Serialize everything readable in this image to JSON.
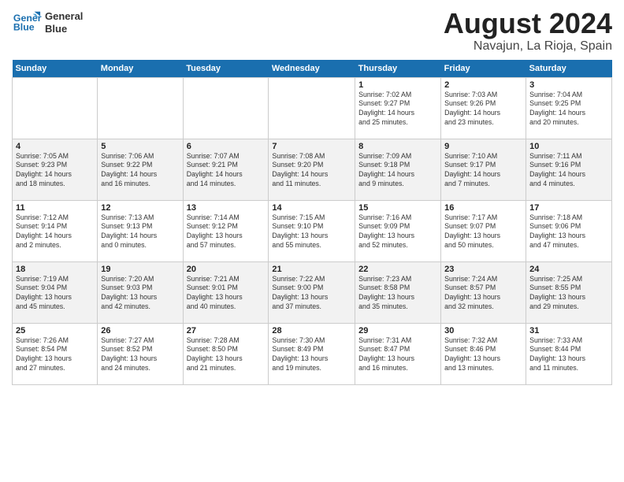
{
  "logo": {
    "line1": "General",
    "line2": "Blue"
  },
  "title": "August 2024",
  "location": "Navajun, La Rioja, Spain",
  "days_of_week": [
    "Sunday",
    "Monday",
    "Tuesday",
    "Wednesday",
    "Thursday",
    "Friday",
    "Saturday"
  ],
  "weeks": [
    [
      {
        "num": "",
        "info": ""
      },
      {
        "num": "",
        "info": ""
      },
      {
        "num": "",
        "info": ""
      },
      {
        "num": "",
        "info": ""
      },
      {
        "num": "1",
        "info": "Sunrise: 7:02 AM\nSunset: 9:27 PM\nDaylight: 14 hours\nand 25 minutes."
      },
      {
        "num": "2",
        "info": "Sunrise: 7:03 AM\nSunset: 9:26 PM\nDaylight: 14 hours\nand 23 minutes."
      },
      {
        "num": "3",
        "info": "Sunrise: 7:04 AM\nSunset: 9:25 PM\nDaylight: 14 hours\nand 20 minutes."
      }
    ],
    [
      {
        "num": "4",
        "info": "Sunrise: 7:05 AM\nSunset: 9:23 PM\nDaylight: 14 hours\nand 18 minutes."
      },
      {
        "num": "5",
        "info": "Sunrise: 7:06 AM\nSunset: 9:22 PM\nDaylight: 14 hours\nand 16 minutes."
      },
      {
        "num": "6",
        "info": "Sunrise: 7:07 AM\nSunset: 9:21 PM\nDaylight: 14 hours\nand 14 minutes."
      },
      {
        "num": "7",
        "info": "Sunrise: 7:08 AM\nSunset: 9:20 PM\nDaylight: 14 hours\nand 11 minutes."
      },
      {
        "num": "8",
        "info": "Sunrise: 7:09 AM\nSunset: 9:18 PM\nDaylight: 14 hours\nand 9 minutes."
      },
      {
        "num": "9",
        "info": "Sunrise: 7:10 AM\nSunset: 9:17 PM\nDaylight: 14 hours\nand 7 minutes."
      },
      {
        "num": "10",
        "info": "Sunrise: 7:11 AM\nSunset: 9:16 PM\nDaylight: 14 hours\nand 4 minutes."
      }
    ],
    [
      {
        "num": "11",
        "info": "Sunrise: 7:12 AM\nSunset: 9:14 PM\nDaylight: 14 hours\nand 2 minutes."
      },
      {
        "num": "12",
        "info": "Sunrise: 7:13 AM\nSunset: 9:13 PM\nDaylight: 14 hours\nand 0 minutes."
      },
      {
        "num": "13",
        "info": "Sunrise: 7:14 AM\nSunset: 9:12 PM\nDaylight: 13 hours\nand 57 minutes."
      },
      {
        "num": "14",
        "info": "Sunrise: 7:15 AM\nSunset: 9:10 PM\nDaylight: 13 hours\nand 55 minutes."
      },
      {
        "num": "15",
        "info": "Sunrise: 7:16 AM\nSunset: 9:09 PM\nDaylight: 13 hours\nand 52 minutes."
      },
      {
        "num": "16",
        "info": "Sunrise: 7:17 AM\nSunset: 9:07 PM\nDaylight: 13 hours\nand 50 minutes."
      },
      {
        "num": "17",
        "info": "Sunrise: 7:18 AM\nSunset: 9:06 PM\nDaylight: 13 hours\nand 47 minutes."
      }
    ],
    [
      {
        "num": "18",
        "info": "Sunrise: 7:19 AM\nSunset: 9:04 PM\nDaylight: 13 hours\nand 45 minutes."
      },
      {
        "num": "19",
        "info": "Sunrise: 7:20 AM\nSunset: 9:03 PM\nDaylight: 13 hours\nand 42 minutes."
      },
      {
        "num": "20",
        "info": "Sunrise: 7:21 AM\nSunset: 9:01 PM\nDaylight: 13 hours\nand 40 minutes."
      },
      {
        "num": "21",
        "info": "Sunrise: 7:22 AM\nSunset: 9:00 PM\nDaylight: 13 hours\nand 37 minutes."
      },
      {
        "num": "22",
        "info": "Sunrise: 7:23 AM\nSunset: 8:58 PM\nDaylight: 13 hours\nand 35 minutes."
      },
      {
        "num": "23",
        "info": "Sunrise: 7:24 AM\nSunset: 8:57 PM\nDaylight: 13 hours\nand 32 minutes."
      },
      {
        "num": "24",
        "info": "Sunrise: 7:25 AM\nSunset: 8:55 PM\nDaylight: 13 hours\nand 29 minutes."
      }
    ],
    [
      {
        "num": "25",
        "info": "Sunrise: 7:26 AM\nSunset: 8:54 PM\nDaylight: 13 hours\nand 27 minutes."
      },
      {
        "num": "26",
        "info": "Sunrise: 7:27 AM\nSunset: 8:52 PM\nDaylight: 13 hours\nand 24 minutes."
      },
      {
        "num": "27",
        "info": "Sunrise: 7:28 AM\nSunset: 8:50 PM\nDaylight: 13 hours\nand 21 minutes."
      },
      {
        "num": "28",
        "info": "Sunrise: 7:30 AM\nSunset: 8:49 PM\nDaylight: 13 hours\nand 19 minutes."
      },
      {
        "num": "29",
        "info": "Sunrise: 7:31 AM\nSunset: 8:47 PM\nDaylight: 13 hours\nand 16 minutes."
      },
      {
        "num": "30",
        "info": "Sunrise: 7:32 AM\nSunset: 8:46 PM\nDaylight: 13 hours\nand 13 minutes."
      },
      {
        "num": "31",
        "info": "Sunrise: 7:33 AM\nSunset: 8:44 PM\nDaylight: 13 hours\nand 11 minutes."
      }
    ]
  ]
}
